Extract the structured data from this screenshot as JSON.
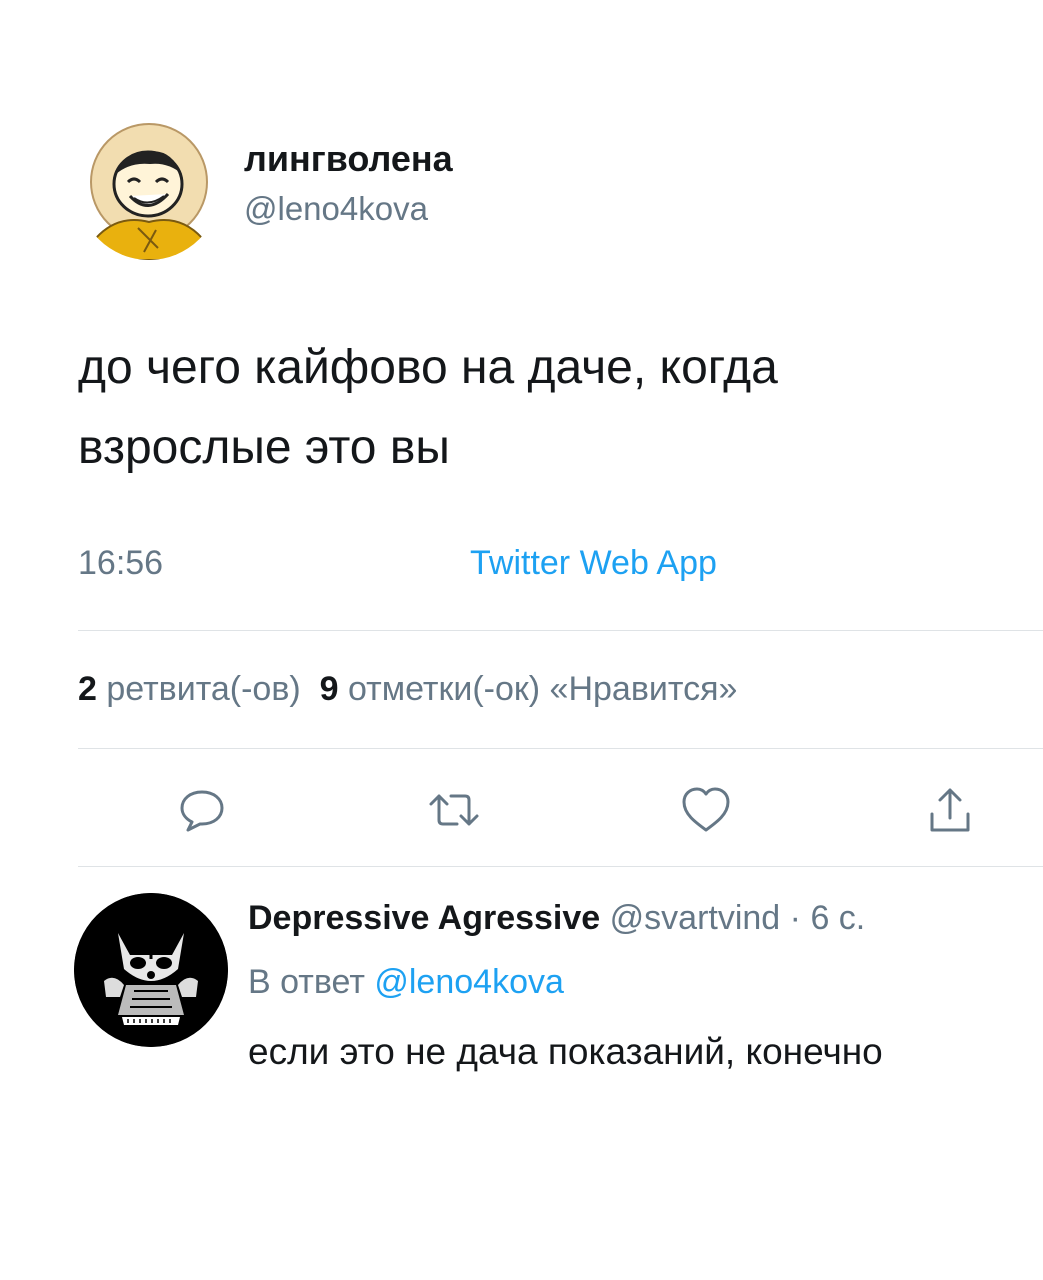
{
  "tweet": {
    "author_name": "лингволена",
    "author_handle": "@leno4kova",
    "text_line1": "до чего кайфово на даче, когда",
    "text_line2": "взрослые это вы",
    "time": "16:56",
    "source": "Twitter Web App",
    "retweets_count": "2",
    "retweets_label": "ретвита(-ов)",
    "likes_count": "9",
    "likes_label": "отметки(-ок) «Нравится»"
  },
  "actions": {
    "icons": [
      "reply-icon",
      "retweet-icon",
      "like-icon",
      "share-icon"
    ]
  },
  "reply": {
    "author_name": "Depressive Agressive",
    "author_handle": "@svartvind",
    "separator": "·",
    "time": "6 с.",
    "reply_prefix": "В ответ",
    "reply_mention": "@leno4kova",
    "text": "если это не дача показаний, конечно"
  },
  "colors": {
    "text": "#14171a",
    "secondary": "#657786",
    "link": "#1da1f2",
    "divider": "#dfe3e6",
    "icon": "#657786"
  }
}
